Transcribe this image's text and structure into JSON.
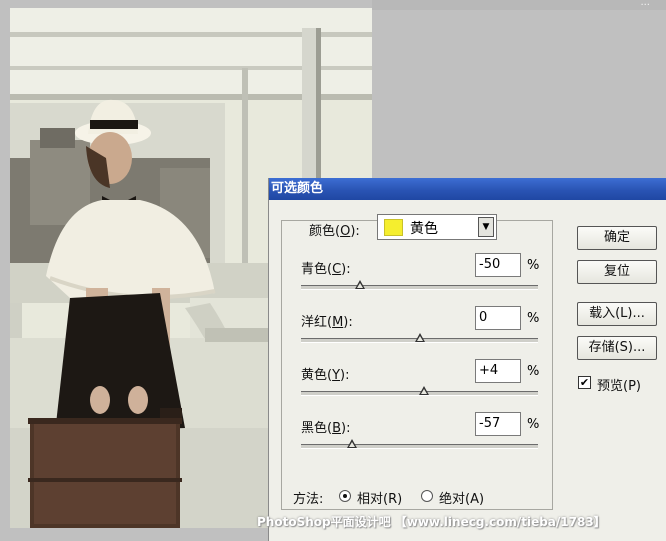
{
  "corner_text": "...",
  "dialog": {
    "title": "可选颜色",
    "colors_label": "颜色(",
    "colors_key": "O",
    "colors_suffix": "):",
    "colors_selected": "黄色",
    "swatch_color": "#f5ee2e",
    "sliders": [
      {
        "label": "青色(",
        "key": "C",
        "suffix": "):",
        "value": "-50",
        "percent": "%",
        "level": -50
      },
      {
        "label": "洋红(",
        "key": "M",
        "suffix": "):",
        "value": "0",
        "percent": "%",
        "level": 0
      },
      {
        "label": "黄色(",
        "key": "Y",
        "suffix": "):",
        "value": "+4",
        "percent": "%",
        "level": 4
      },
      {
        "label": "黑色(",
        "key": "B",
        "suffix": "):",
        "value": "-57",
        "percent": "%",
        "level": -57
      }
    ],
    "buttons": {
      "ok": "确定",
      "reset": "复位",
      "load": "载入(L)...",
      "save": "存储(S)..."
    },
    "preview_label": "预览(P)",
    "preview_checked": true,
    "method_label": "方法:",
    "method_relative": "相对(R)",
    "method_absolute": "绝对(A)",
    "method_selected": "relative"
  },
  "watermark": "PhotoShop平面设计吧 【www.linecg.com/tieba/1783】",
  "accent_title_bar": "#2a54b4"
}
